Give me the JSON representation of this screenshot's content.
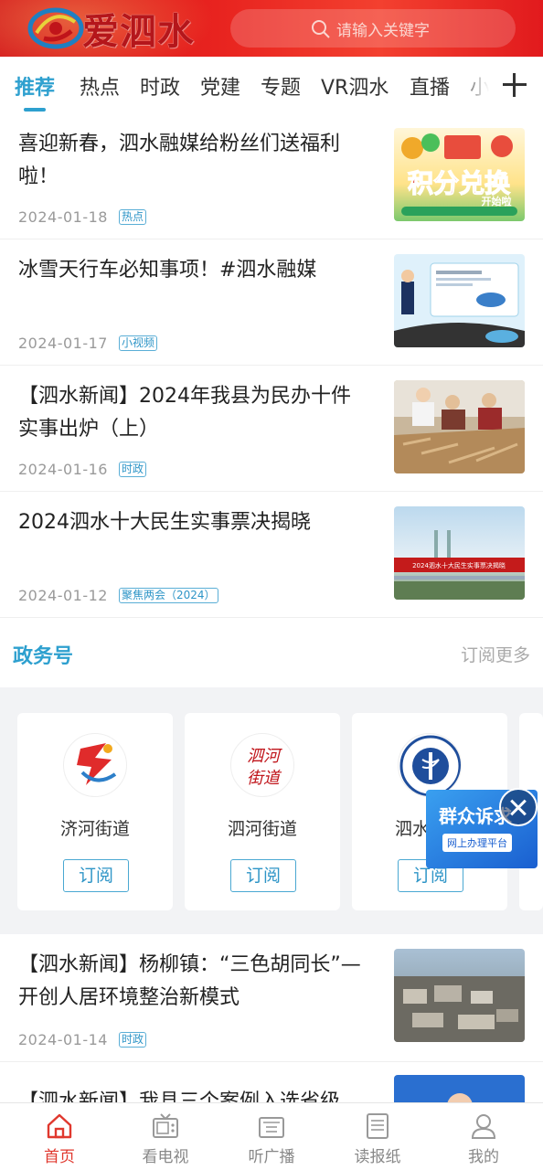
{
  "header": {
    "logo_text": "爱泗水",
    "search_placeholder": "请输入关键字",
    "brand_color": "#e1201f"
  },
  "tabs": [
    {
      "label": "推荐",
      "active": true
    },
    {
      "label": "热点"
    },
    {
      "label": "时政"
    },
    {
      "label": "党建"
    },
    {
      "label": "专题"
    },
    {
      "label": "VR泗水"
    },
    {
      "label": "直播"
    },
    {
      "label": "小"
    }
  ],
  "news_top": [
    {
      "title": "喜迎新春，泗水融媒给粉丝们送福利啦！",
      "date": "2024-01-18",
      "tag": "热点",
      "thumb_text": "积分兑换",
      "thumb_sub": "开始啦"
    },
    {
      "title": "冰雪天行车必知事项！#泗水融媒",
      "date": "2024-01-17",
      "tag": "小视频"
    },
    {
      "title": "【泗水新闻】2024年我县为民办十件实事出炉（上）",
      "date": "2024-01-16",
      "tag": "时政"
    },
    {
      "title": "2024泗水十大民生实事票决揭晓",
      "date": "2024-01-12",
      "tag": "聚焦两会（2024）",
      "thumb_text": "2024泗水十大民生实事票决揭晓"
    }
  ],
  "gov_section": {
    "title": "政务号",
    "more": "订阅更多",
    "cards": [
      {
        "name": "济河街道",
        "button": "订阅"
      },
      {
        "name": "泗河街道",
        "button": "订阅",
        "logo_text": "泗河街道"
      },
      {
        "name": "泗水县卫",
        "button": "订阅"
      }
    ]
  },
  "float_badge": {
    "title": "群众诉求",
    "subtitle": "网上办理平台"
  },
  "news_bottom": [
    {
      "title": "【泗水新闻】杨柳镇：“三色胡同长”—开创人居环境整治新模式",
      "date": "2024-01-14",
      "tag": "时政"
    },
    {
      "title": "【泗水新闻】我县三个案例入选省级",
      "date": "",
      "tag": ""
    }
  ],
  "bottom_nav": [
    {
      "label": "首页",
      "icon": "home-icon",
      "active": true
    },
    {
      "label": "看电视",
      "icon": "tv-icon"
    },
    {
      "label": "听广播",
      "icon": "radio-icon"
    },
    {
      "label": "读报纸",
      "icon": "newspaper-icon"
    },
    {
      "label": "我的",
      "icon": "user-icon"
    }
  ]
}
